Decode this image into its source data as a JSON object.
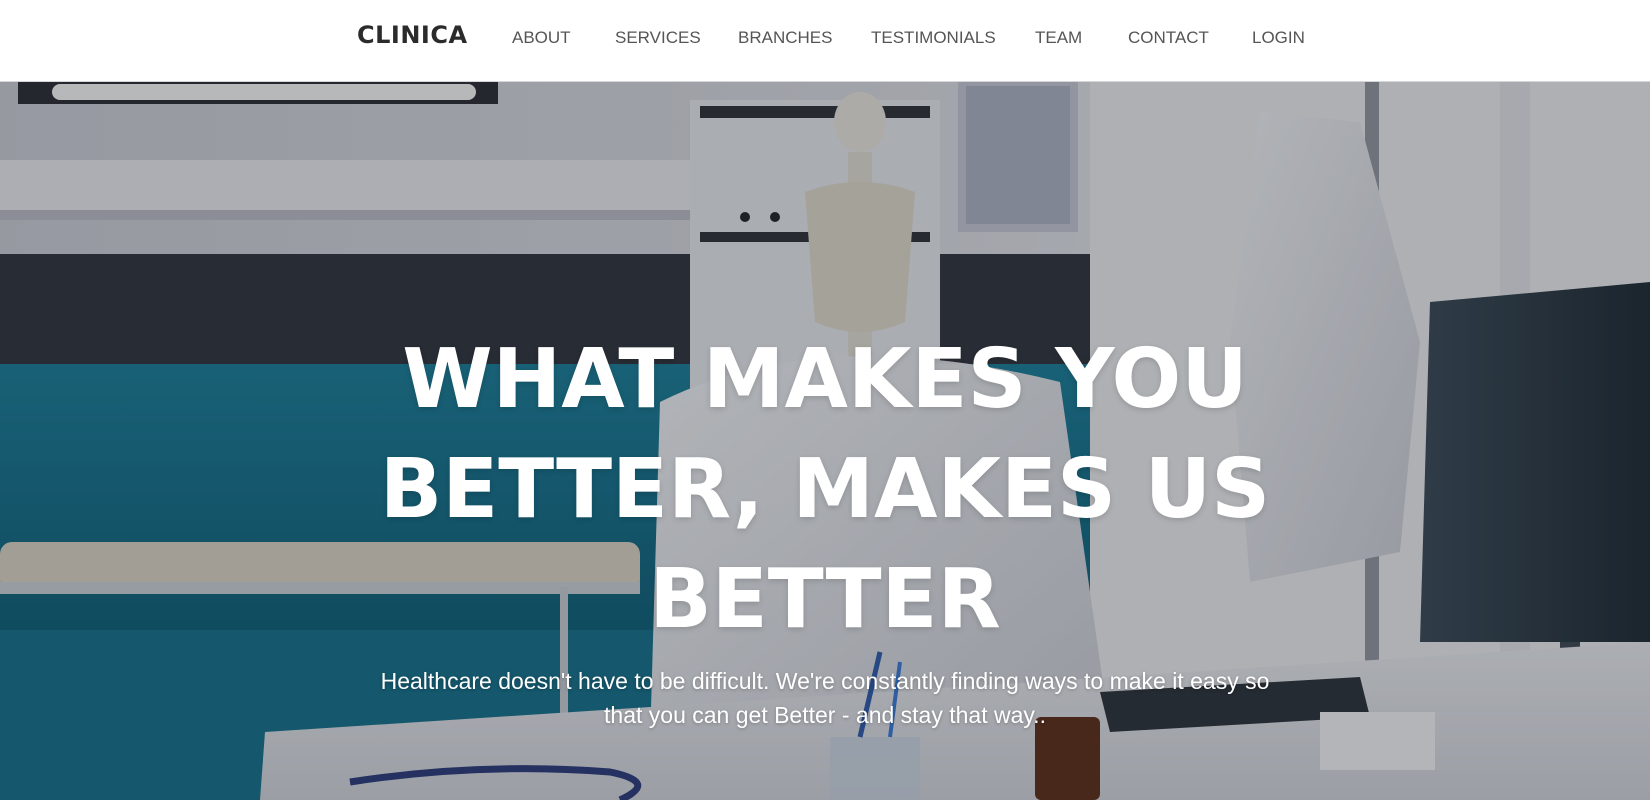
{
  "brand": {
    "name": "CLINICA"
  },
  "nav": {
    "items": [
      {
        "label": "ABOUT"
      },
      {
        "label": "SERVICES"
      },
      {
        "label": "BRANCHES"
      },
      {
        "label": "TESTIMONIALS"
      },
      {
        "label": "TEAM"
      },
      {
        "label": "CONTACT"
      },
      {
        "label": "LOGIN"
      }
    ]
  },
  "hero": {
    "title": "WHAT MAKES YOU BETTER, MAKES US BETTER",
    "subtitle": "Healthcare doesn't have to be difficult. We're constantly finding ways to make it easy so that you can get Better - and stay that way..",
    "background_image": "medical-office-photo"
  },
  "colors": {
    "nav_background": "#ffffff",
    "brand_text": "#2b2b2b",
    "nav_text": "#555555",
    "hero_text": "#ffffff",
    "accent_teal": "#167a93"
  }
}
